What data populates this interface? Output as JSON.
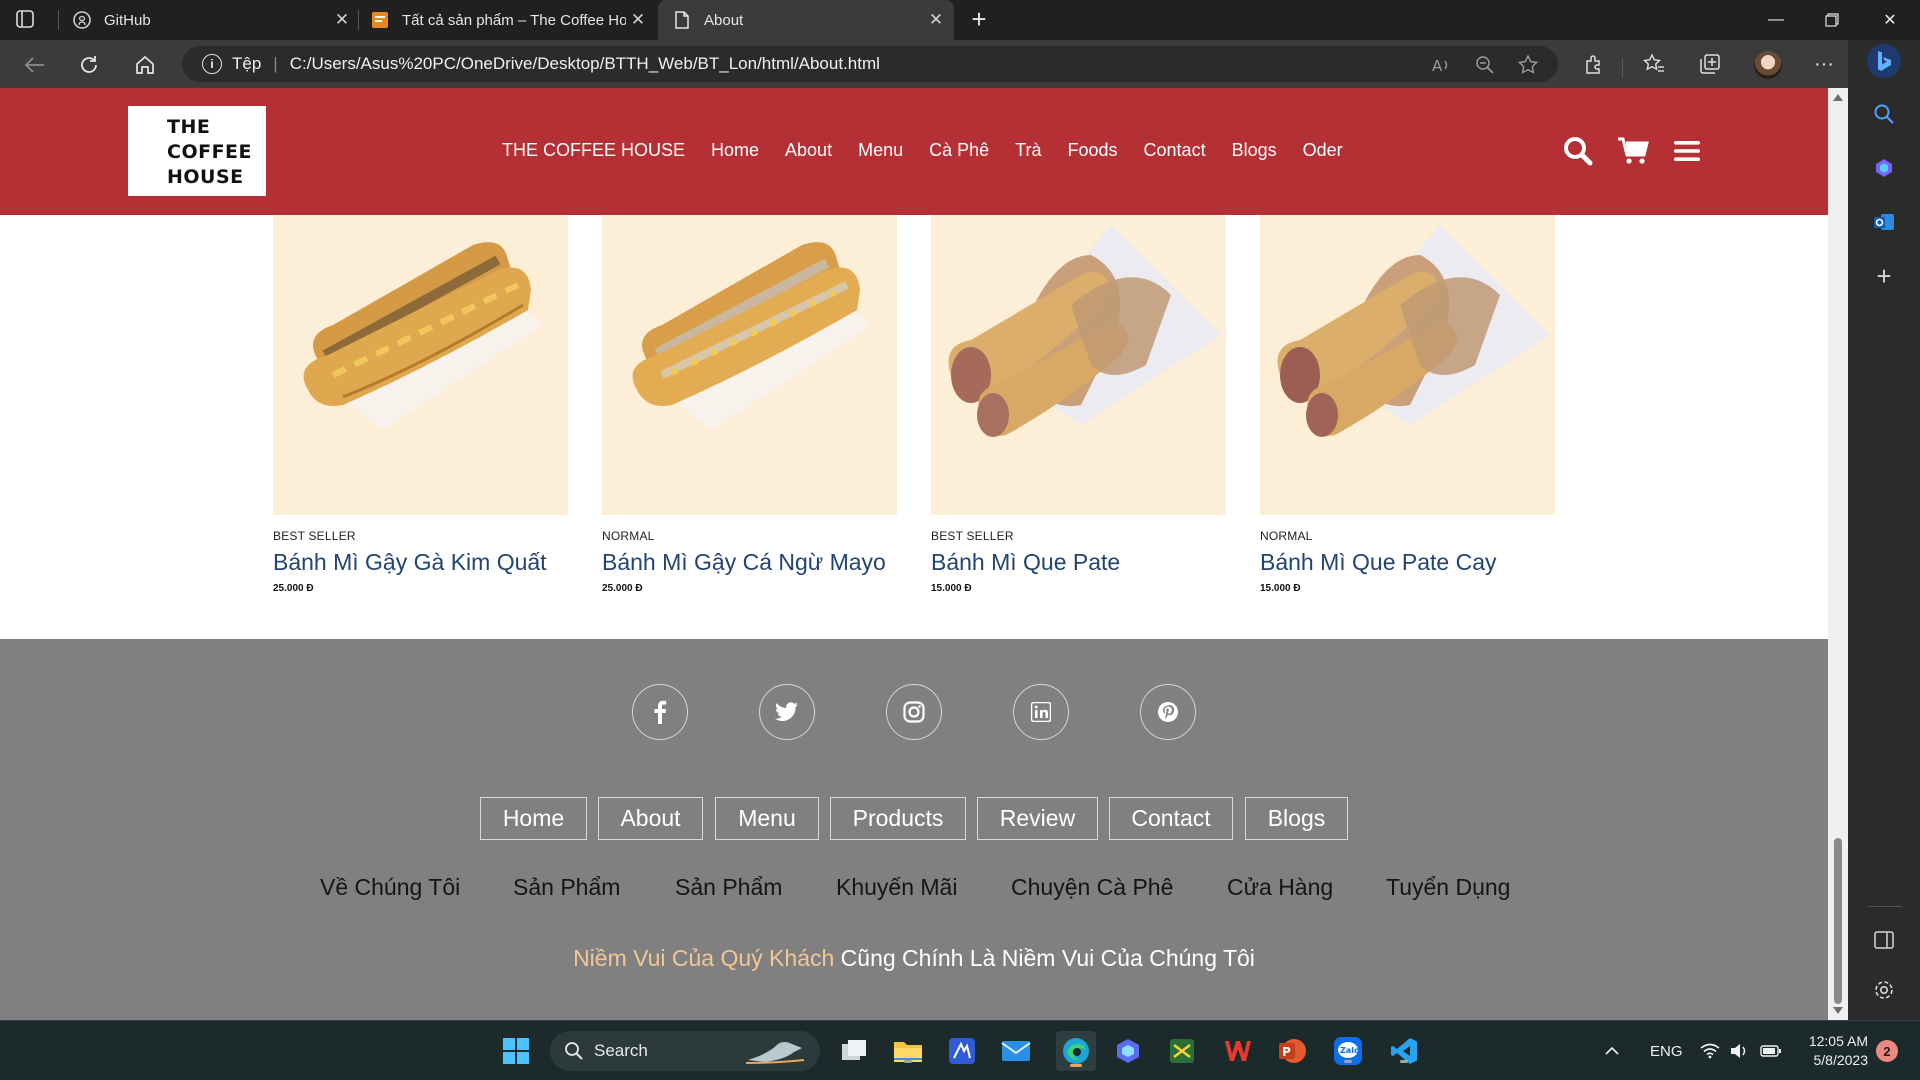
{
  "browser": {
    "tabs": [
      {
        "title": "GitHub",
        "icon": "github-icon"
      },
      {
        "title": "Tất cả sản phẩm – The Coffee House",
        "icon": "page-orange-icon"
      },
      {
        "title": "About",
        "icon": "page-icon",
        "active": true
      }
    ],
    "address": {
      "scheme_label": "Tệp",
      "url": "C:/Users/Asus%20PC/OneDrive/Desktop/BTTH_Web/BT_Lon/html/About.html"
    }
  },
  "site": {
    "logo_lines": [
      "THE",
      "COFFEE",
      "HOUSE"
    ],
    "nav": [
      "THE COFFEE HOUSE",
      "Home",
      "About",
      "Menu",
      "Cà Phê",
      "Trà",
      "Foods",
      "Contact",
      "Blogs",
      "Oder"
    ],
    "header_color": "#b43035"
  },
  "products": [
    {
      "tag": "BEST SELLER",
      "name": "Bánh Mì Gậy Gà Kim Quất",
      "price": "25.000 Đ",
      "image": "baguette-chicken"
    },
    {
      "tag": "NORMAL",
      "name": "Bánh Mì Gậy Cá Ngừ Mayo",
      "price": "25.000 Đ",
      "image": "baguette-tuna"
    },
    {
      "tag": "BEST SELLER",
      "name": "Bánh Mì Que Pate",
      "price": "15.000 Đ",
      "image": "stick-bread-pate"
    },
    {
      "tag": "NORMAL",
      "name": "Bánh Mì Que Pate Cay",
      "price": "15.000 Đ",
      "image": "stick-bread-pate-spicy"
    }
  ],
  "footer": {
    "social": [
      "facebook-icon",
      "twitter-icon",
      "instagram-icon",
      "linkedin-icon",
      "pinterest-icon"
    ],
    "nav": [
      "Home",
      "About",
      "Menu",
      "Products",
      "Review",
      "Contact",
      "Blogs"
    ],
    "links": [
      "Về Chúng Tôi",
      "Sản Phẩm",
      "Sản Phẩm",
      "Khuyến Mãi",
      "Chuyện Cà Phê",
      "Cửa Hàng",
      "Tuyển Dụng"
    ],
    "tagline_highlight": "Niềm Vui Của Quý Khách",
    "tagline_rest": " Cũng Chính Là Niềm Vui Của Chúng Tôi",
    "highlight_color": "#f2c796"
  },
  "taskbar": {
    "search_label": "Search",
    "lang": "ENG",
    "time": "12:05 AM",
    "date": "5/8/2023",
    "notifications": "2"
  }
}
